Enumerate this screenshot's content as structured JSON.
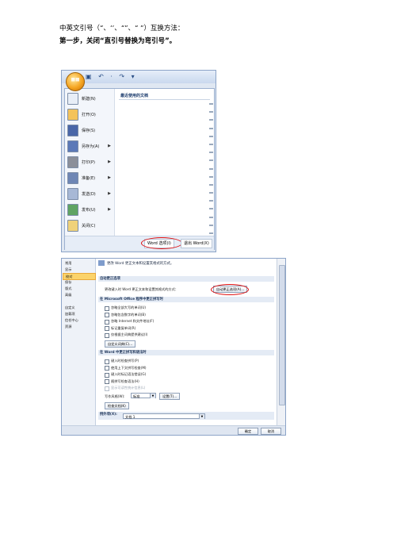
{
  "doc": {
    "intro": "中英文引号（“、‘’、“”、“ ”）互换方法：",
    "step1": "第一步，关闭“直引号替换为弯引号”。"
  },
  "office_menu": {
    "recent_title": "最近使用的文档",
    "items": [
      {
        "label": "新建(N)",
        "color": "#e8eef7",
        "arrow": false
      },
      {
        "label": "打开(O)",
        "color": "#f4c35a",
        "arrow": false
      },
      {
        "label": "保存(S)",
        "color": "#4a67a8",
        "arrow": false
      },
      {
        "label": "另存为(A)",
        "color": "#5b79b8",
        "arrow": true
      },
      {
        "label": "打印(P)",
        "color": "#8b8f99",
        "arrow": true
      },
      {
        "label": "准备(E)",
        "color": "#6e86b5",
        "arrow": true
      },
      {
        "label": "发送(D)",
        "color": "#a7b8d6",
        "arrow": true
      },
      {
        "label": "发布(U)",
        "color": "#5fa463",
        "arrow": true
      },
      {
        "label": "关闭(C)",
        "color": "#f0d27a",
        "arrow": false
      }
    ],
    "options_button": "Word 选项(I)",
    "exit_button": "退出 Word(X)"
  },
  "word_options": {
    "nav": [
      "常用",
      "显示",
      "校对",
      "保存",
      "版式",
      "高级",
      "",
      "自定义",
      "加载项",
      "信任中心",
      "资源"
    ],
    "header": "更改 Word 更正文本和设置其格式的方式。",
    "section_autocorrect": "自动更正选项",
    "autocorrect_desc": "更改键入时 Word 更正文本和设置其格式的方式：",
    "autocorrect_button": "自动更正选项(A)...",
    "section_office": "在 Microsoft Office 程序中更正拼写时",
    "office_checks": [
      {
        "label": "忽略全部大写的单词(U)",
        "disabled": false
      },
      {
        "label": "忽略包含数字的单词(B)",
        "disabled": false
      },
      {
        "label": "忽略 Internet 和文件地址(F)",
        "disabled": false
      },
      {
        "label": "标记重复单词(R)",
        "disabled": false
      },
      {
        "label": "仅根据主词典提供建议(I)",
        "disabled": false
      }
    ],
    "custom_dict_button": "自定义词典(C)...",
    "section_word": "在 Word 中更正拼写和语法时",
    "word_checks": [
      {
        "label": "键入时检查拼写(P)",
        "disabled": false
      },
      {
        "label": "使用上下文拼写检查(M)",
        "disabled": false
      },
      {
        "label": "键入时标记语法错误(G)",
        "disabled": false
      },
      {
        "label": "随拼写检查语法(H)",
        "disabled": false
      },
      {
        "label": "显示可读性统计信息(L)",
        "disabled": true
      }
    ],
    "writing_style_label": "写作风格(W):",
    "writing_style_value": "标准",
    "settings_button": "设置(T)...",
    "recheck_button": "检查文档(K)",
    "exception_label": "例外项(X):",
    "exception_value": "文档 1",
    "ok_button": "确定",
    "cancel_button": "取消"
  }
}
